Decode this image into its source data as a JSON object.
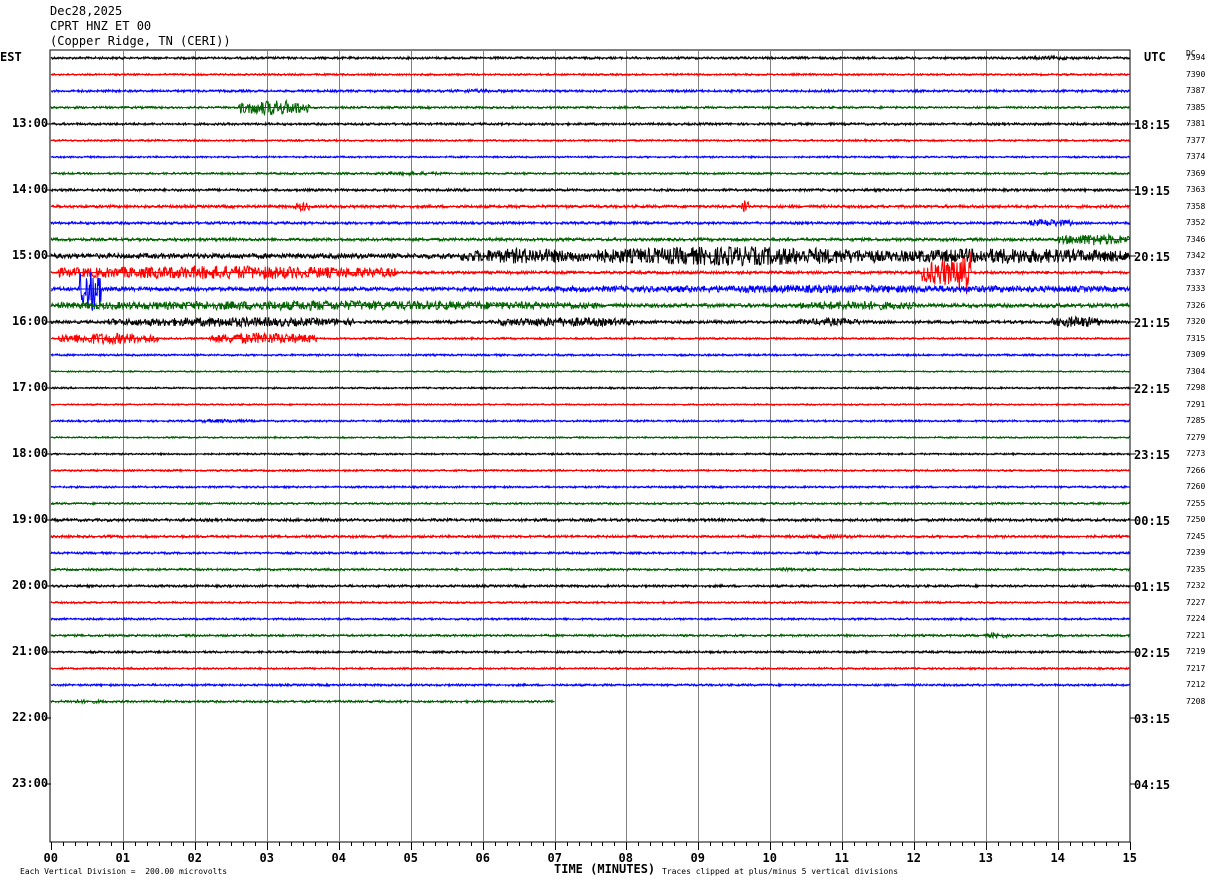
{
  "header": {
    "date": "Dec28,2025",
    "station": "CPRT HNZ ET 00",
    "location": "(Copper Ridge, TN (CERI))"
  },
  "left_zone": "EST",
  "right_zone": "UTC",
  "dc_label": "DC",
  "est_labels": [
    "13:00",
    "14:00",
    "15:00",
    "16:00",
    "17:00",
    "18:00",
    "19:00",
    "20:00",
    "21:00",
    "22:00",
    "23:00"
  ],
  "utc_labels": [
    "18:15",
    "19:15",
    "20:15",
    "21:15",
    "22:15",
    "23:15",
    "00:15",
    "01:15",
    "02:15",
    "03:15",
    "04:15"
  ],
  "footer": {
    "left": "Each Vertical Division =  200.00 microvolts",
    "center": "TIME (MINUTES)",
    "right": "Traces clipped at plus/minus 5 vertical divisions"
  },
  "colors": {
    "trace_cycle": [
      "#000000",
      "#ff0000",
      "#0000ff",
      "#006400"
    ],
    "grid": "#808080"
  },
  "chart_data": {
    "type": "line",
    "title": "CPRT HNZ ET 00",
    "xlabel": "TIME (MINUTES)",
    "x_ticks": [
      "00",
      "01",
      "02",
      "03",
      "04",
      "05",
      "06",
      "07",
      "08",
      "09",
      "10",
      "11",
      "12",
      "13",
      "14",
      "15"
    ],
    "xlim": [
      0,
      15
    ],
    "trace_minutes": 15,
    "traces": [
      {
        "dc": "7394",
        "amp": 1.2,
        "bursts": [
          [
            13.5,
            14.3,
            2
          ]
        ]
      },
      {
        "dc": "7390",
        "amp": 1.0,
        "bursts": []
      },
      {
        "dc": "7387",
        "amp": 1.2,
        "bursts": [
          [
            5.5,
            6.3,
            2
          ]
        ]
      },
      {
        "dc": "7385",
        "amp": 1.1,
        "bursts": [
          [
            2.6,
            3.6,
            8
          ]
        ]
      },
      {
        "dc": "7381",
        "amp": 1.2,
        "bursts": []
      },
      {
        "dc": "7377",
        "amp": 1.0,
        "bursts": []
      },
      {
        "dc": "7374",
        "amp": 0.9,
        "bursts": []
      },
      {
        "dc": "7369",
        "amp": 1.0,
        "bursts": [
          [
            4.5,
            5.5,
            2
          ]
        ]
      },
      {
        "dc": "7363",
        "amp": 1.3,
        "bursts": []
      },
      {
        "dc": "7358",
        "amp": 1.5,
        "bursts": [
          [
            3.4,
            3.6,
            5
          ],
          [
            9.6,
            9.7,
            9
          ]
        ]
      },
      {
        "dc": "7352",
        "amp": 1.3,
        "bursts": [
          [
            13.6,
            14.2,
            4
          ]
        ]
      },
      {
        "dc": "7346",
        "amp": 1.5,
        "bursts": [
          [
            14.0,
            15.0,
            6
          ]
        ]
      },
      {
        "dc": "7342",
        "amp": 2.5,
        "bursts": [
          [
            5.7,
            7.5,
            8
          ],
          [
            7.5,
            11.5,
            10
          ],
          [
            11.5,
            15.0,
            8
          ]
        ]
      },
      {
        "dc": "7337",
        "amp": 1.5,
        "bursts": [
          [
            0.1,
            4.8,
            7
          ],
          [
            12.1,
            12.7,
            14
          ],
          [
            12.6,
            12.8,
            30
          ]
        ]
      },
      {
        "dc": "7333",
        "amp": 2.0,
        "bursts": [
          [
            0.4,
            0.7,
            25
          ],
          [
            6.8,
            15.0,
            4
          ]
        ]
      },
      {
        "dc": "7326",
        "amp": 2.0,
        "bursts": [
          [
            0.1,
            7.6,
            5
          ],
          [
            10.4,
            12.0,
            5
          ]
        ]
      },
      {
        "dc": "7320",
        "amp": 1.5,
        "bursts": [
          [
            0.8,
            4.2,
            5
          ],
          [
            6.2,
            8.1,
            5
          ],
          [
            10.4,
            11.3,
            4
          ],
          [
            13.9,
            14.6,
            6
          ]
        ]
      },
      {
        "dc": "7315",
        "amp": 1.0,
        "bursts": [
          [
            0.1,
            1.5,
            6
          ],
          [
            2.2,
            3.7,
            6
          ]
        ]
      },
      {
        "dc": "7309",
        "amp": 1.0,
        "bursts": []
      },
      {
        "dc": "7304",
        "amp": 0.7,
        "bursts": []
      },
      {
        "dc": "7298",
        "amp": 0.9,
        "bursts": []
      },
      {
        "dc": "7291",
        "amp": 0.8,
        "bursts": []
      },
      {
        "dc": "7285",
        "amp": 1.0,
        "bursts": [
          [
            2.0,
            2.8,
            2
          ]
        ]
      },
      {
        "dc": "7279",
        "amp": 0.8,
        "bursts": []
      },
      {
        "dc": "7273",
        "amp": 0.9,
        "bursts": []
      },
      {
        "dc": "7266",
        "amp": 1.0,
        "bursts": []
      },
      {
        "dc": "7260",
        "amp": 1.0,
        "bursts": []
      },
      {
        "dc": "7255",
        "amp": 1.0,
        "bursts": []
      },
      {
        "dc": "7250",
        "amp": 1.4,
        "bursts": []
      },
      {
        "dc": "7245",
        "amp": 1.3,
        "bursts": [
          [
            10.2,
            11.4,
            2
          ]
        ]
      },
      {
        "dc": "7239",
        "amp": 1.1,
        "bursts": []
      },
      {
        "dc": "7235",
        "amp": 1.1,
        "bursts": [
          [
            10.0,
            10.6,
            2
          ]
        ]
      },
      {
        "dc": "7232",
        "amp": 1.2,
        "bursts": []
      },
      {
        "dc": "7227",
        "amp": 1.0,
        "bursts": []
      },
      {
        "dc": "7224",
        "amp": 1.0,
        "bursts": []
      },
      {
        "dc": "7221",
        "amp": 1.1,
        "bursts": [
          [
            13.0,
            13.3,
            3
          ]
        ]
      },
      {
        "dc": "7219",
        "amp": 1.1,
        "bursts": []
      },
      {
        "dc": "7217",
        "amp": 1.0,
        "bursts": []
      },
      {
        "dc": "7212",
        "amp": 1.1,
        "bursts": []
      },
      {
        "dc": "7208",
        "amp": 1.1,
        "bursts": [
          [
            0.1,
            0.8,
            2
          ]
        ],
        "end": 7.0
      }
    ]
  }
}
